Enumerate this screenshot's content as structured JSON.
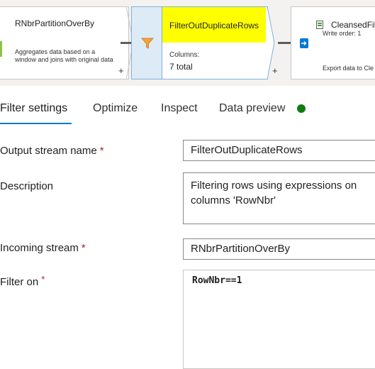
{
  "flow": {
    "prev_node": {
      "title": "RNbrPartitionOverBy",
      "description": "Aggregates data based on a window and joins with original data"
    },
    "selected_node": {
      "title": "FilterOutDuplicateRows",
      "columns_label": "Columns:",
      "columns_value": "7 total"
    },
    "next_node": {
      "title": "CleansedFil",
      "write_order": "Write order: 1",
      "description": "Export data to Cle"
    },
    "plus": "+"
  },
  "tabs": [
    {
      "label": "Filter settings",
      "active": true
    },
    {
      "label": "Optimize",
      "active": false
    },
    {
      "label": "Inspect",
      "active": false
    },
    {
      "label": "Data preview",
      "active": false
    }
  ],
  "data_preview_status_color": "#107c10",
  "form": {
    "output_stream": {
      "label": "Output stream name",
      "required": "*",
      "value": "FilterOutDuplicateRows"
    },
    "description": {
      "label": "Description",
      "value": "Filtering rows using expressions on columns 'RowNbr'"
    },
    "incoming_stream": {
      "label": "Incoming stream",
      "required": "*",
      "value": "RNbrPartitionOverBy"
    },
    "filter_on": {
      "label": "Filter on",
      "required": "*",
      "value": "RowNbr==1"
    }
  },
  "icons": {
    "filter": "filter-funnel-icon",
    "sink": "sink-database-icon",
    "file": "dataset-file-icon"
  },
  "colors": {
    "accent": "#0078d4",
    "highlight": "#ffff00",
    "required": "#a4262c"
  }
}
